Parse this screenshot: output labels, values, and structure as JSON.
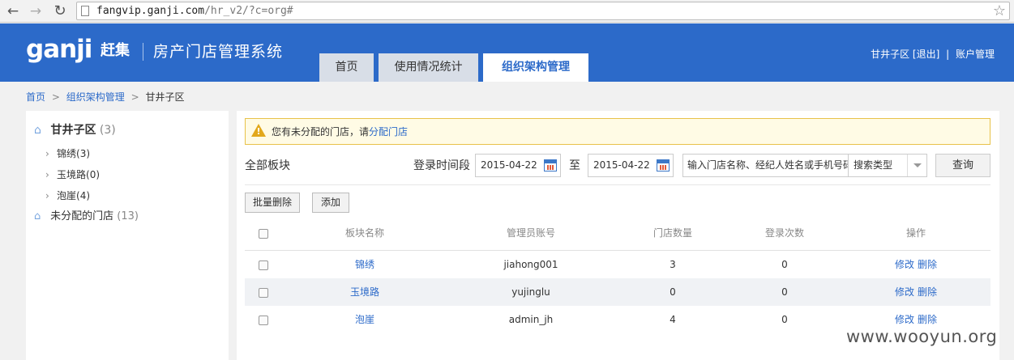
{
  "browser": {
    "url_host": "fangvip.ganji.com",
    "url_path": "/hr_v2/?c=org#"
  },
  "header": {
    "logo_text": "ganji",
    "logo_cn": "赶集",
    "system_title": "房产门店管理系统",
    "tabs": [
      {
        "label": "首页"
      },
      {
        "label": "使用情况统计"
      },
      {
        "label": "组织架构管理"
      }
    ],
    "user_name": "甘井子区",
    "logout_label": "[退出]",
    "separator": "|",
    "account_label": "账户管理"
  },
  "breadcrumb": {
    "items": [
      "首页",
      "组织架构管理",
      "甘井子区"
    ],
    "sep": ">"
  },
  "sidebar": {
    "root": {
      "name": "甘井子区",
      "count": "(3)"
    },
    "children": [
      {
        "name": "锦绣",
        "count": "(3)"
      },
      {
        "name": "玉境路",
        "count": "(0)"
      },
      {
        "name": "泡崖",
        "count": "(4)"
      }
    ],
    "unassigned": {
      "name": "未分配的门店",
      "count": "(13)"
    }
  },
  "notice": {
    "text": "您有未分配的门店，请",
    "link": "分配门店"
  },
  "filters": {
    "all_blocks_label": "全部板块",
    "time_label": "登录时间段",
    "date_from": "2015-04-22",
    "to_label": "至",
    "date_to": "2015-04-22",
    "search_placeholder": "输入门店名称、经纪人姓名或手机号码",
    "search_type": "搜索类型",
    "query_label": "查询"
  },
  "actions": {
    "batch_delete": "批量删除",
    "add": "添加"
  },
  "table": {
    "headers": [
      "板块名称",
      "管理员账号",
      "门店数量",
      "登录次数",
      "操作"
    ],
    "rows": [
      {
        "name": "锦绣",
        "account": "jiahong001",
        "stores": "3",
        "logins": "0",
        "edit": "修改",
        "delete": "删除"
      },
      {
        "name": "玉境路",
        "account": "yujinglu",
        "stores": "0",
        "logins": "0",
        "edit": "修改",
        "delete": "删除"
      },
      {
        "name": "泡崖",
        "account": "admin_jh",
        "stores": "4",
        "logins": "0",
        "edit": "修改",
        "delete": "删除"
      }
    ]
  },
  "watermark": "www.wooyun.org",
  "icons": {
    "back": "arrow-left-icon",
    "forward": "arrow-right-icon",
    "reload": "reload-icon",
    "star": "star-icon",
    "home": "home-icon",
    "warning": "warning-icon",
    "calendar": "calendar-icon"
  },
  "colors": {
    "brand_blue": "#2c6ac9",
    "notice_bg": "#fffbe5",
    "notice_border": "#e8c24a"
  }
}
